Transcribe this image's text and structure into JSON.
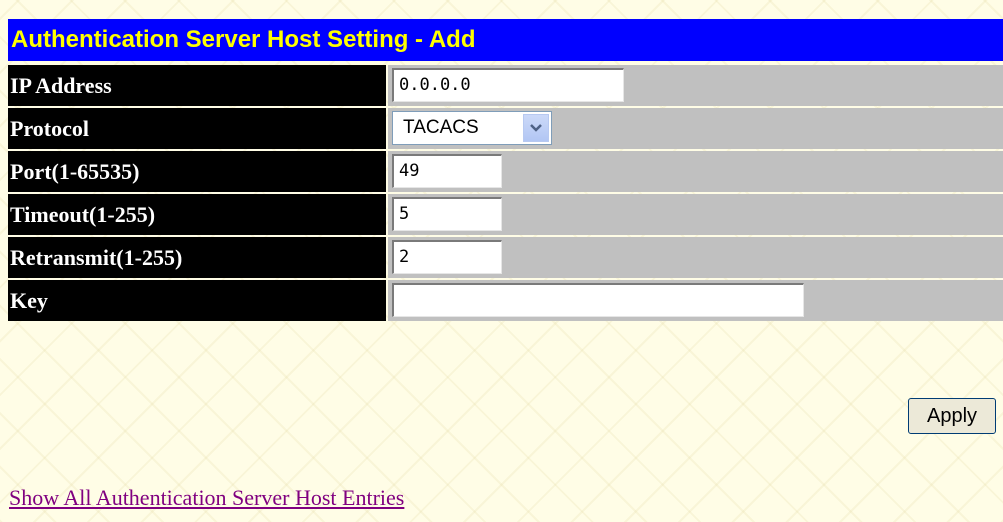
{
  "title": "Authentication Server Host Setting - Add",
  "fields": {
    "ip_address": {
      "label": "IP Address",
      "value": "0.0.0.0"
    },
    "protocol": {
      "label": "Protocol",
      "value": "TACACS"
    },
    "port": {
      "label": "Port(1-65535)",
      "value": "49"
    },
    "timeout": {
      "label": "Timeout(1-255)",
      "value": "5"
    },
    "retransmit": {
      "label": "Retransmit(1-255)",
      "value": "2"
    },
    "key": {
      "label": "Key",
      "value": ""
    }
  },
  "apply_label": "Apply",
  "show_all_link": "Show All Authentication Server Host Entries",
  "colors": {
    "title_bg": "#0000ff",
    "title_text": "#ffff00",
    "label_bg": "#000000",
    "label_text": "#ffffff",
    "value_bg": "#c0c0c0",
    "page_bg": "#fffde6",
    "link": "#800080"
  }
}
